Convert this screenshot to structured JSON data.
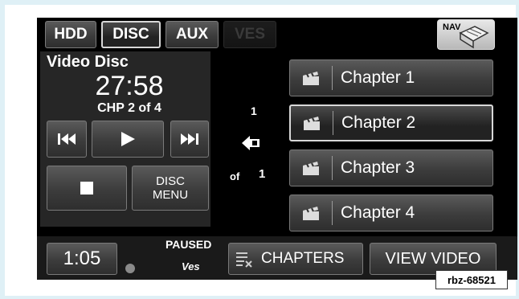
{
  "source_tabs": [
    {
      "label": "HDD",
      "state": "normal"
    },
    {
      "label": "DISC",
      "state": "active"
    },
    {
      "label": "AUX",
      "state": "normal"
    },
    {
      "label": "VES",
      "state": "disabled"
    }
  ],
  "nav_label": "NAV",
  "player": {
    "media_label": "Video Disc",
    "elapsed_time": "27:58",
    "chapter_status": "CHP 2 of 4",
    "disc_menu_line1": "DISC",
    "disc_menu_line2": "MENU"
  },
  "pager": {
    "page": "1",
    "of_label": "of",
    "total": "1"
  },
  "chapters": [
    {
      "label": "Chapter 1",
      "selected": false
    },
    {
      "label": "Chapter 2",
      "selected": true
    },
    {
      "label": "Chapter 3",
      "selected": false
    },
    {
      "label": "Chapter 4",
      "selected": false
    }
  ],
  "footer": {
    "clock": "1:05",
    "status": "PAUSED",
    "ves_label": "Ves",
    "chapters_label": "CHAPTERS",
    "view_video_label": "VIEW VIDEO"
  },
  "watermark": "rbz-68521",
  "icons": {
    "prev": "skip-back-icon",
    "play": "play-icon",
    "next": "skip-forward-icon",
    "stop": "stop-icon",
    "clapper": "clapperboard-icon",
    "back": "back-arrow-icon",
    "nav": "nav-map-icon"
  }
}
